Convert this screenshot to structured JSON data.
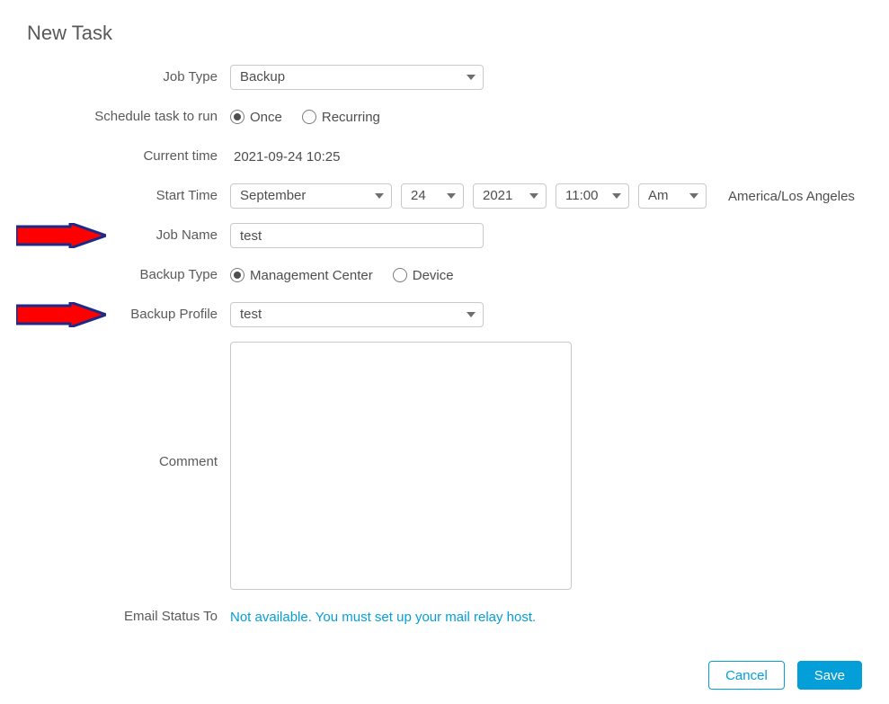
{
  "title": "New Task",
  "labels": {
    "job_type": "Job Type",
    "schedule": "Schedule task to run",
    "current_time": "Current time",
    "start_time": "Start Time",
    "job_name": "Job Name",
    "backup_type": "Backup Type",
    "backup_profile": "Backup Profile",
    "comment": "Comment",
    "email_status": "Email Status To"
  },
  "job_type": {
    "value": "Backup"
  },
  "schedule": {
    "options": {
      "once": "Once",
      "recurring": "Recurring"
    },
    "selected": "once"
  },
  "current_time": "2021-09-24 10:25",
  "start_time": {
    "month": "September",
    "day": "24",
    "year": "2021",
    "time": "11:00",
    "ampm": "Am",
    "timezone": "America/Los Angeles"
  },
  "job_name": {
    "value": "test"
  },
  "backup_type": {
    "options": {
      "mc": "Management Center",
      "device": "Device"
    },
    "selected": "mc"
  },
  "backup_profile": {
    "value": "test"
  },
  "comment": {
    "value": ""
  },
  "email_status": "Not available. You must set up your mail relay host.",
  "buttons": {
    "cancel": "Cancel",
    "save": "Save"
  }
}
